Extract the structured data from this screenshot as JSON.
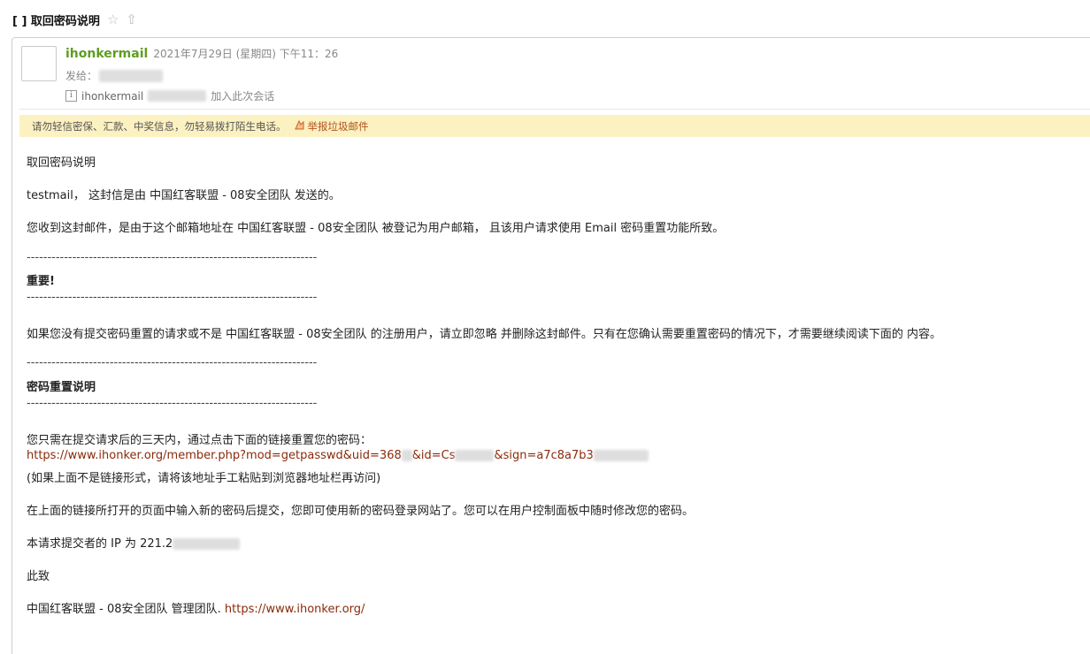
{
  "subject": {
    "text": "[ ] 取回密码说明",
    "star_icon": "star-outline-icon",
    "star_glyph": "☆",
    "move_icon": "arrow-up-icon",
    "move_glyph": "⇧"
  },
  "header": {
    "sender_name": "ihonkermail",
    "date": "2021年7月29日 (星期四) 下午11：26",
    "to_label": "发给：",
    "info_sender": "ihonkermail",
    "info_suffix": "加入此次会话"
  },
  "warning": {
    "text": "请勿轻信密保、汇款、中奖信息，勿轻易拨打陌生电话。",
    "report_label": "举报垃圾邮件"
  },
  "body": {
    "title": "取回密码说明",
    "greeting": "testmail， 这封信是由 中国红客联盟 - 08安全团队 发送的。",
    "reason": "您收到这封邮件，是由于这个邮箱地址在 中国红客联盟 - 08安全团队 被登记为用户邮箱， 且该用户请求使用 Email 密码重置功能所致。",
    "separator": "----------------------------------------------------------------------",
    "important_title": "重要!",
    "important_text": "如果您没有提交密码重置的请求或不是 中国红客联盟 - 08安全团队 的注册用户，请立即忽略 并删除这封邮件。只有在您确认需要重置密码的情况下，才需要继续阅读下面的 内容。",
    "reset_title": "密码重置说明",
    "reset_intro": "您只需在提交请求后的三天内，通过点击下面的链接重置您的密码：",
    "reset_link_a": "https://www.ihonker.org/member.php?mod=getpasswd&uid=368",
    "reset_link_b": "&id=Cs",
    "reset_link_c": "&sign=a7c8a7b3",
    "reset_hint": "(如果上面不是链接形式，请将该地址手工粘贴到浏览器地址栏再访问)",
    "after_submit": "在上面的链接所打开的页面中输入新的密码后提交，您即可使用新的密码登录网站了。您可以在用户控制面板中随时修改您的密码。",
    "ip_text": "本请求提交者的 IP 为 221.2",
    "regards": "此致",
    "signature_text": "中国红客联盟 - 08安全团队 管理团队. ",
    "signature_link": "https://www.ihonker.org/"
  },
  "colors": {
    "sender": "#5f9d23",
    "warning_bg": "#fcf1c0",
    "link": "#8a2a0a"
  }
}
